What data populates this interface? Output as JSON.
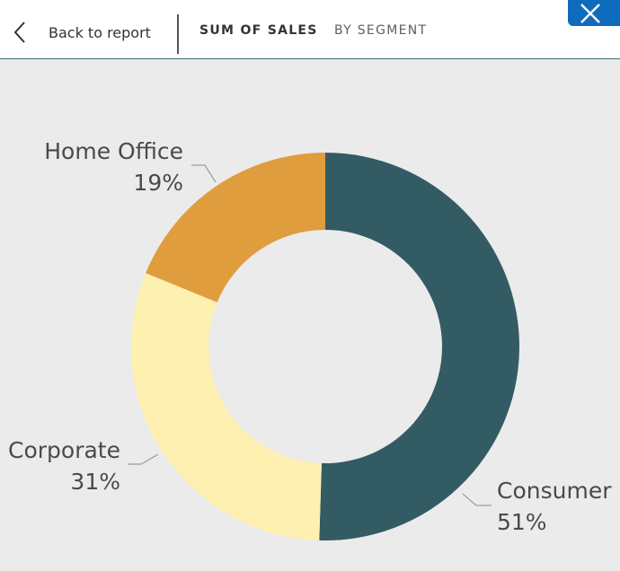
{
  "header": {
    "back_label": "Back to report",
    "tabs": [
      {
        "label": "SUM OF SALES",
        "active": true
      },
      {
        "label": "BY SEGMENT",
        "active": false
      }
    ]
  },
  "close_button": {
    "icon": "close-icon",
    "color": "#0e6bbd"
  },
  "colors": {
    "background": "#ebebeb",
    "header_border": "#3a6b73"
  },
  "chart_data": {
    "type": "pie",
    "title": "",
    "donut": true,
    "slices": [
      {
        "label": "Consumer",
        "percent_label": "51%",
        "value": 51,
        "color": "#335b63"
      },
      {
        "label": "Corporate",
        "percent_label": "31%",
        "value": 31,
        "color": "#fdf0b0"
      },
      {
        "label": "Home Office",
        "percent_label": "19%",
        "value": 19,
        "color": "#e09d3e"
      }
    ]
  }
}
